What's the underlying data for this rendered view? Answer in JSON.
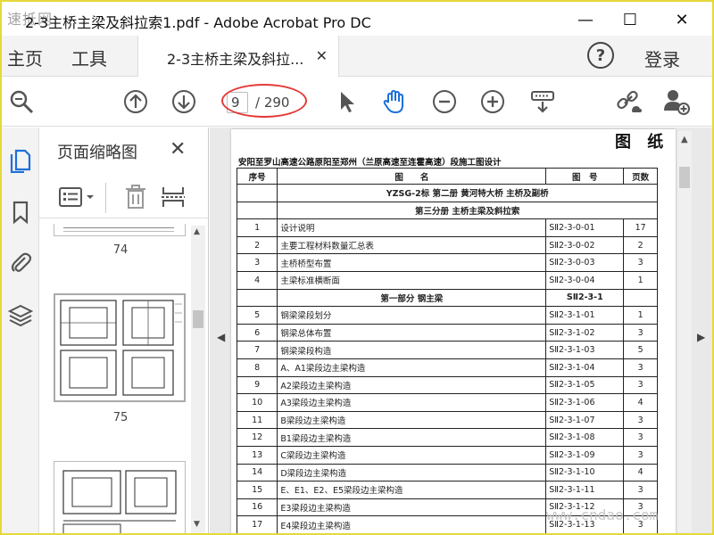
{
  "window": {
    "logo_text": "速抵网",
    "title": "2-3主桥主梁及斜拉索1.pdf - Adobe Acrobat Pro DC",
    "min_glyph": "—",
    "max_glyph": "☐",
    "close_glyph": "✕"
  },
  "tabs": {
    "home": "主页",
    "tools": "工具",
    "document": "2-3主桥主梁及斜拉...",
    "close_glyph": "✕",
    "help_glyph": "?",
    "login": "登录"
  },
  "toolbar": {
    "current_page": "9",
    "total_pages": "/ 290",
    "icons": [
      "search-zoom-icon",
      "page-up-icon",
      "page-down-icon",
      "select-arrow-icon",
      "hand-tool-icon",
      "zoom-out-icon",
      "zoom-in-icon",
      "keyboard-scroll-icon",
      "share-link-icon",
      "add-user-icon"
    ]
  },
  "thumbnails": {
    "panel_title": "页面缩略图",
    "close_glyph": "✕",
    "pages": [
      "74",
      "75"
    ]
  },
  "document": {
    "heading": "图 纸",
    "project": "安阳至罗山高速公路原阳至郑州（兰原高速至连霍高速）段施工图设计",
    "columns": [
      "序号",
      "图　　名",
      "图　号",
      "页数"
    ],
    "rows": [
      {
        "type": "section",
        "name": "YZSG-2标  第二册 黄河特大桥 主桥及副桥"
      },
      {
        "type": "section",
        "name": "第三分册 主桥主梁及斜拉索"
      },
      {
        "seq": "1",
        "name": "设计说明",
        "code": "SⅡ2-3-0-01",
        "pages": "17"
      },
      {
        "seq": "2",
        "name": "主要工程材料数量汇总表",
        "code": "SⅡ2-3-0-02",
        "pages": "2"
      },
      {
        "seq": "3",
        "name": "主桥桥型布置",
        "code": "SⅡ2-3-0-03",
        "pages": "3"
      },
      {
        "seq": "4",
        "name": "主梁标准横断面",
        "code": "SⅡ2-3-0-04",
        "pages": "1"
      },
      {
        "type": "section",
        "name": "第一部分 钢主梁",
        "code": "SⅡ2-3-1"
      },
      {
        "seq": "5",
        "name": "钢梁梁段划分",
        "code": "SⅡ2-3-1-01",
        "pages": "1"
      },
      {
        "seq": "6",
        "name": "钢梁总体布置",
        "code": "SⅡ2-3-1-02",
        "pages": "3"
      },
      {
        "seq": "7",
        "name": "钢梁梁段构造",
        "code": "SⅡ2-3-1-03",
        "pages": "5"
      },
      {
        "seq": "8",
        "name": "A、A1梁段边主梁构造",
        "code": "SⅡ2-3-1-04",
        "pages": "3"
      },
      {
        "seq": "9",
        "name": "A2梁段边主梁构造",
        "code": "SⅡ2-3-1-05",
        "pages": "3"
      },
      {
        "seq": "10",
        "name": "A3梁段边主梁构造",
        "code": "SⅡ2-3-1-06",
        "pages": "4"
      },
      {
        "seq": "11",
        "name": "B梁段边主梁构造",
        "code": "SⅡ2-3-1-07",
        "pages": "3"
      },
      {
        "seq": "12",
        "name": "B1梁段边主梁构造",
        "code": "SⅡ2-3-1-08",
        "pages": "3"
      },
      {
        "seq": "13",
        "name": "C梁段边主梁构造",
        "code": "SⅡ2-3-1-09",
        "pages": "3"
      },
      {
        "seq": "14",
        "name": "D梁段边主梁构造",
        "code": "SⅡ2-3-1-10",
        "pages": "4"
      },
      {
        "seq": "15",
        "name": "E、E1、E2、E5梁段边主梁构造",
        "code": "SⅡ2-3-1-11",
        "pages": "3"
      },
      {
        "seq": "16",
        "name": "E3梁段边主梁构造",
        "code": "SⅡ2-3-1-12",
        "pages": "3"
      },
      {
        "seq": "17",
        "name": "E4梁段边主梁构造",
        "code": "SⅡ2-3-1-13",
        "pages": "3"
      }
    ]
  },
  "watermark": "www.cndao.com"
}
